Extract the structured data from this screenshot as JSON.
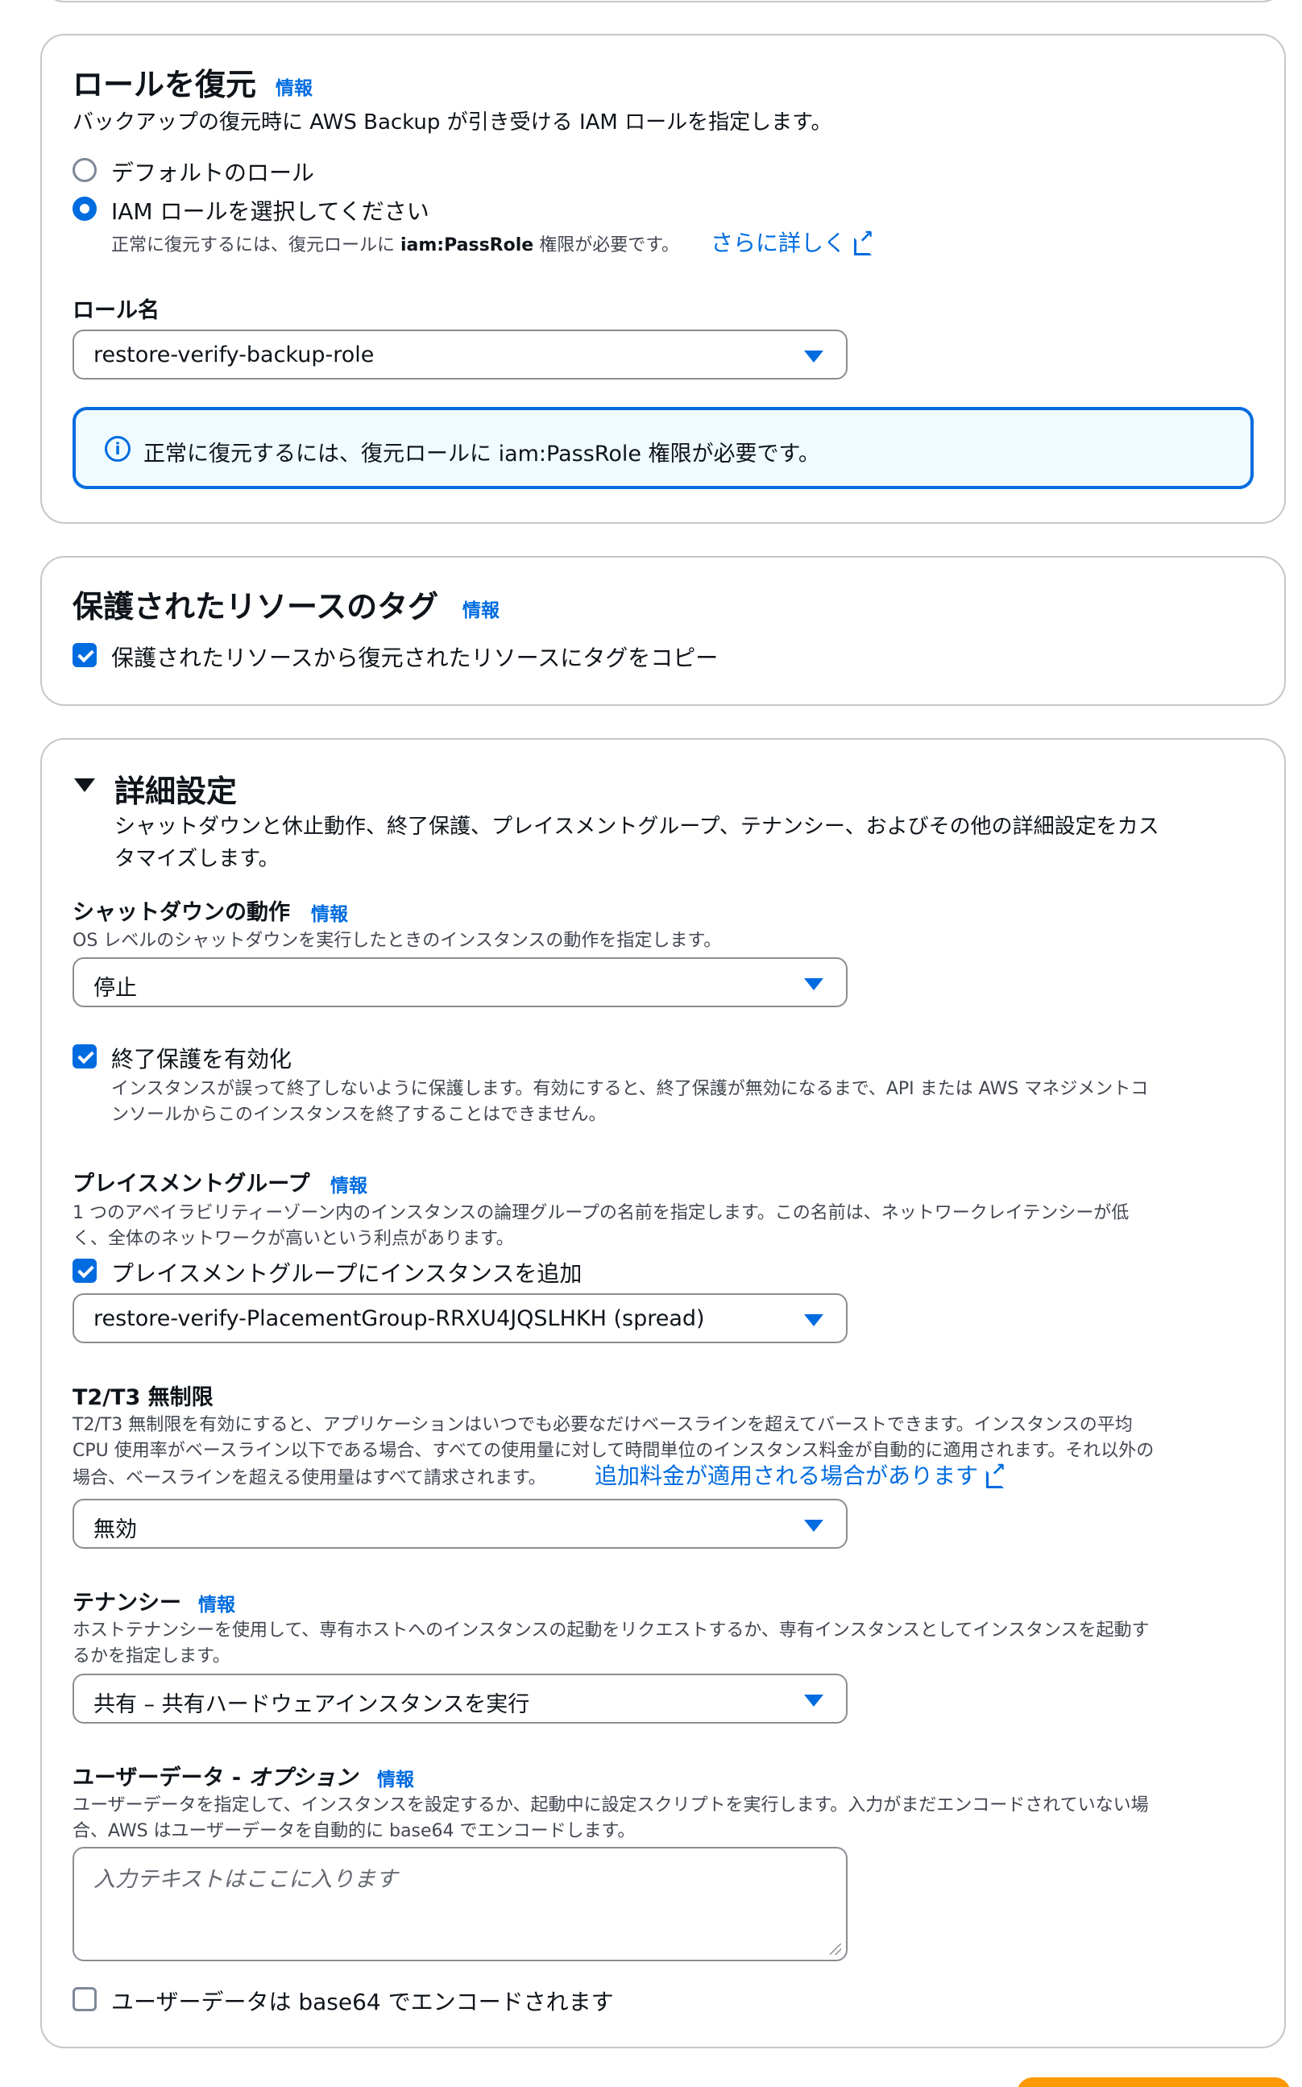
{
  "restore_role": {
    "title": "ロールを復元",
    "info": "情報",
    "description": "バックアップの復元時に AWS Backup が引き受ける IAM ロールを指定します。",
    "options": [
      {
        "label": "デフォルトのロール",
        "selected": false
      },
      {
        "label": "IAM ロールを選択してください",
        "selected": true
      }
    ],
    "hint_prefix": "正常に復元するには、復元ロールに ",
    "hint_bold": "iam:PassRole",
    "hint_suffix": " 権限が必要です。",
    "learn_more": "さらに詳しく",
    "role_name_label": "ロール名",
    "role_name_value": "restore-verify-backup-role",
    "alert_text": "正常に復元するには、復元ロールに iam:PassRole 権限が必要です。"
  },
  "protected_tags": {
    "title": "保護されたリソースのタグ",
    "info": "情報",
    "copy_tags_label": "保護されたリソースから復元されたリソースにタグをコピー",
    "copy_tags_checked": true
  },
  "advanced": {
    "title": "詳細設定",
    "description_line1": "シャットダウンと休止動作、終了保護、プレイスメントグループ、テナンシー、およびその他の詳細設定をカス",
    "description_line2": "タマイズします。",
    "shutdown": {
      "label": "シャットダウンの動作",
      "info": "情報",
      "description": "OS レベルのシャットダウンを実行したときのインスタンスの動作を指定します。",
      "value": "停止"
    },
    "termination_protection": {
      "label": "終了保護を有効化",
      "checked": true,
      "description_line1": "インスタンスが誤って終了しないように保護します。有効にすると、終了保護が無効になるまで、API または AWS マネジメントコ",
      "description_line2": "ンソールからこのインスタンスを終了することはできません。"
    },
    "placement_group": {
      "label": "プレイスメントグループ",
      "info": "情報",
      "description_line1": "1 つのアベイラビリティーゾーン内のインスタンスの論理グループの名前を指定します。この名前は、ネットワークレイテンシーが低",
      "description_line2": "く、全体のネットワークが高いという利点があります。",
      "add_label": "プレイスメントグループにインスタンスを追加",
      "add_checked": true,
      "value": "restore-verify-PlacementGroup-RRXU4JQSLHKH (spread)"
    },
    "t2t3": {
      "label": "T2/T3 無制限",
      "description_line1": "T2/T3 無制限を有効にすると、アプリケーションはいつでも必要なだけベースラインを超えてバーストできます。インスタンスの平均",
      "description_line2": "CPU 使用率がベースライン以下である場合、すべての使用量に対して時間単位のインスタンス料金が自動的に適用されます。それ以外の",
      "description_line3": "場合、ベースラインを超える使用量はすべて請求されます。",
      "link": "追加料金が適用される場合があります",
      "value": "無効"
    },
    "tenancy": {
      "label": "テナンシー",
      "info": "情報",
      "description_line1": "ホストテナンシーを使用して、専有ホストへのインスタンスの起動をリクエストするか、専有インスタンスとしてインスタンスを起動す",
      "description_line2": "るかを指定します。",
      "value": "共有 – 共有ハードウェアインスタンスを実行"
    },
    "user_data": {
      "label": "ユーザーデータ - ",
      "label_optional": "オプション",
      "info": "情報",
      "description_line1": "ユーザーデータを指定して、インスタンスを設定するか、起動中に設定スクリプトを実行します。入力がまだエンコードされていない場",
      "description_line2": "合、AWS はユーザーデータを自動的に base64 でエンコードします。",
      "placeholder": "入力テキストはここに入ります",
      "base64_label": "ユーザーデータは base64 でエンコードされます",
      "base64_checked": false
    }
  },
  "colors": {
    "accent": "#006ce0",
    "border": "#c6c6cd",
    "text": "#0f141a",
    "secondary_text": "#424650",
    "alert_bg": "#f0fbff",
    "primary_button": "#ff9900"
  }
}
